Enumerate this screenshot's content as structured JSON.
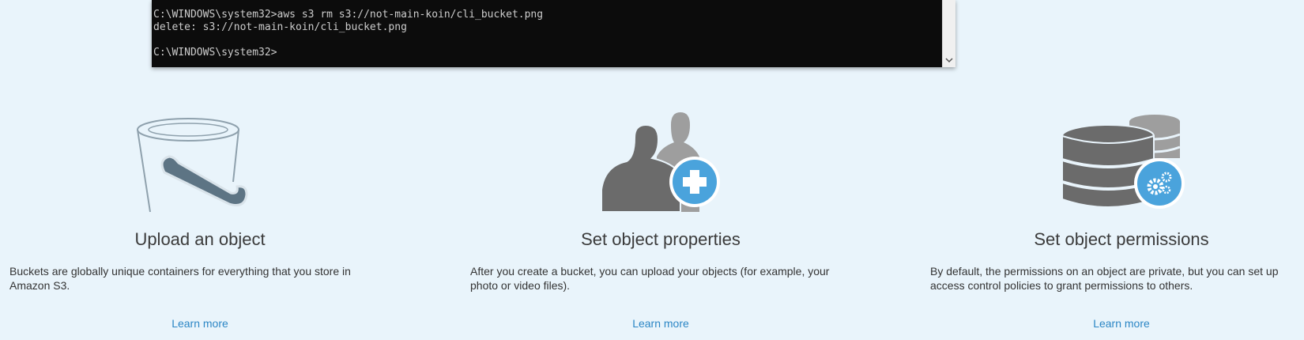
{
  "terminal": {
    "lines": [
      "C:\\WINDOWS\\system32>aws s3 rm s3://not-main-koin/cli_bucket.png",
      "delete: s3://not-main-koin/cli_bucket.png",
      "",
      "C:\\WINDOWS\\system32>"
    ]
  },
  "cards": [
    {
      "icon": "bucket-icon",
      "title": "Upload an object",
      "description": "Buckets are globally unique containers for everything that you store in Amazon S3.",
      "link": "Learn more"
    },
    {
      "icon": "users-add-icon",
      "title": "Set object properties",
      "description": "After you create a bucket, you can upload your objects (for example, your photo or video files).",
      "link": "Learn more"
    },
    {
      "icon": "database-settings-icon",
      "title": "Set object permissions",
      "description": "By default, the permissions on an object are private, but you can set up access control policies to grant permissions to others.",
      "link": "Learn more"
    }
  ],
  "colors": {
    "background": "#e9f4fb",
    "terminal_bg": "#0c0c0c",
    "terminal_text": "#cccccc",
    "link": "#2b86c5",
    "icon_gray": "#6b6b6b",
    "icon_light_gray": "#9e9e9e",
    "badge_blue": "#4aa3dc"
  }
}
